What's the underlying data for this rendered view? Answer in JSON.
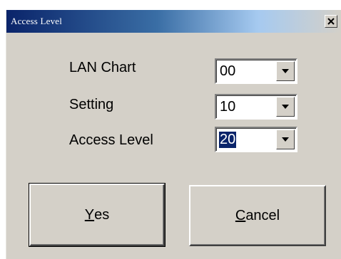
{
  "dialog": {
    "title": "Access  Level",
    "close_label": "×"
  },
  "fields": [
    {
      "label": "LAN Chart",
      "value": "00",
      "selected": false
    },
    {
      "label": "Setting",
      "value": "10",
      "selected": false
    },
    {
      "label": "Access Level",
      "value": "20",
      "selected": true
    }
  ],
  "buttons": {
    "yes": {
      "mnemonic": "Y",
      "rest": "es"
    },
    "cancel": {
      "mnemonic": "C",
      "rest": "ancel"
    }
  },
  "icons": {
    "close": "close-icon",
    "dropdown": "chevron-down-icon"
  },
  "colors": {
    "titlebar_start": "#0a246a",
    "titlebar_end": "#a6caf0",
    "dialog_bg": "#d4d0c8",
    "selection": "#0a246a"
  }
}
